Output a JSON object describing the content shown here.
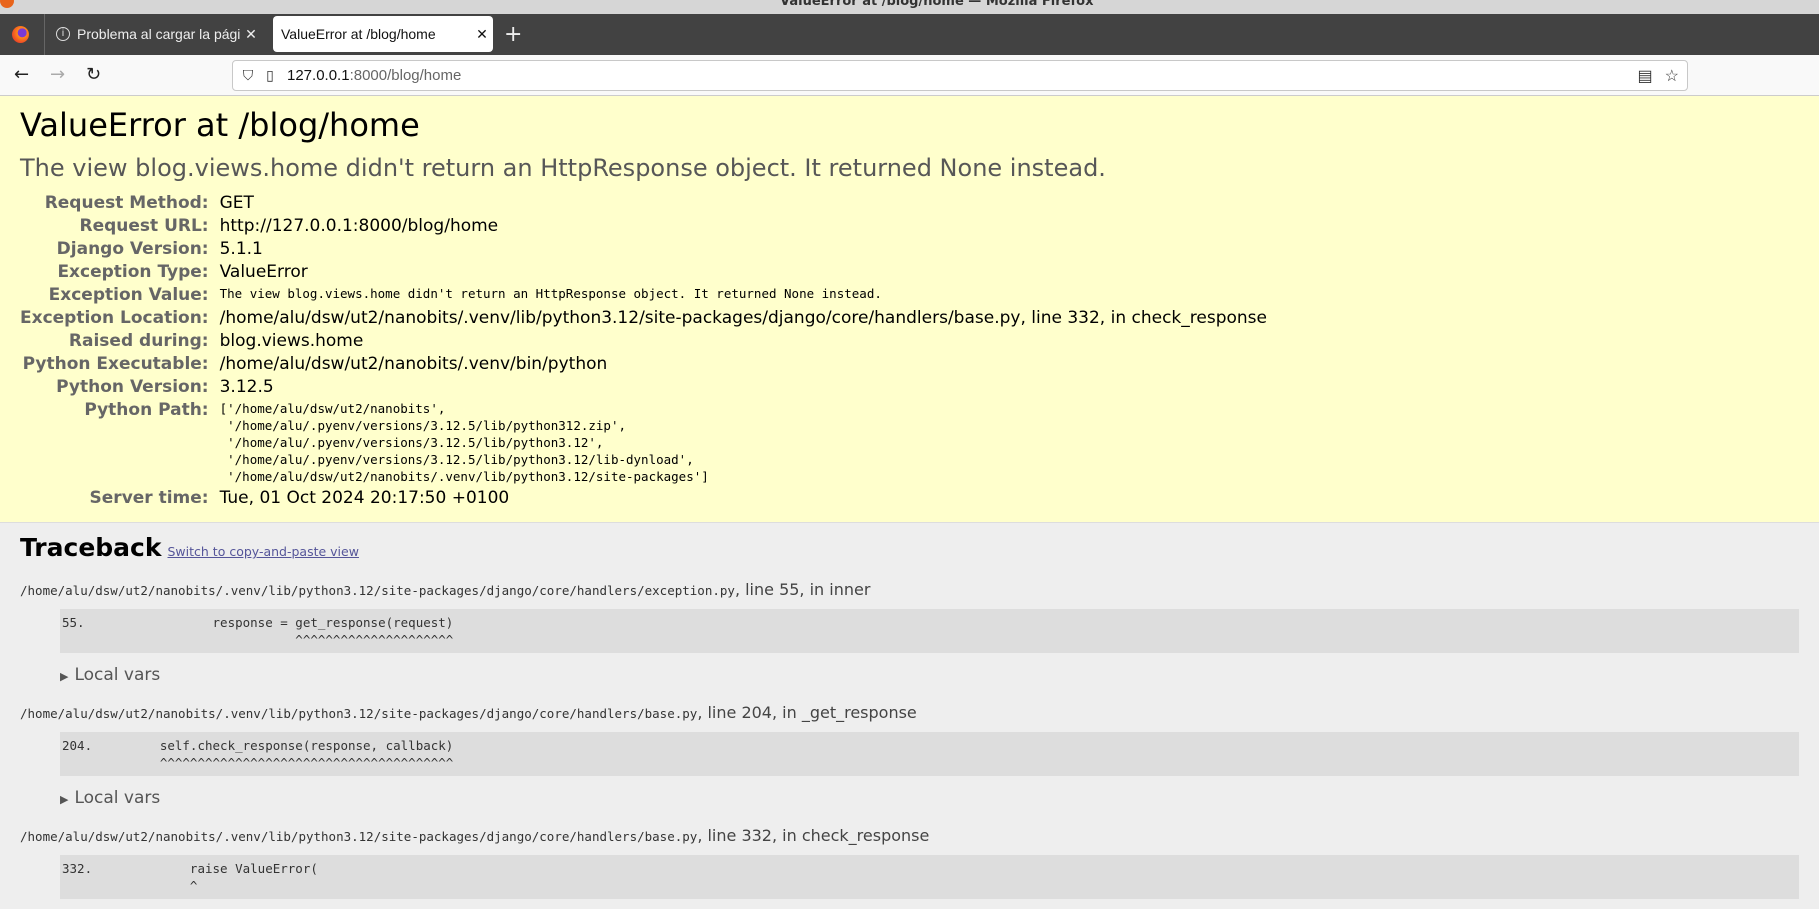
{
  "window": {
    "title": "ValueError at /blog/home — Mozilla Firefox"
  },
  "tabs": [
    {
      "label": "Problema al cargar la página",
      "active": false
    },
    {
      "label": "ValueError at /blog/home",
      "active": true
    }
  ],
  "nav": {
    "url_host": "127.0.0.1",
    "url_rest": ":8000/blog/home"
  },
  "summary": {
    "title": "ValueError at /blog/home",
    "subtitle": "The view blog.views.home didn't return an HttpResponse object. It returned None instead.",
    "rows": [
      {
        "label": "Request Method:",
        "value": "GET"
      },
      {
        "label": "Request URL:",
        "value": "http://127.0.0.1:8000/blog/home"
      },
      {
        "label": "Django Version:",
        "value": "5.1.1"
      },
      {
        "label": "Exception Type:",
        "value": "ValueError"
      },
      {
        "label": "Exception Value:",
        "value": "The view blog.views.home didn't return an HttpResponse object. It returned None instead."
      },
      {
        "label": "Exception Location:",
        "value": "/home/alu/dsw/ut2/nanobits/.venv/lib/python3.12/site-packages/django/core/handlers/base.py, line 332, in check_response"
      },
      {
        "label": "Raised during:",
        "value": "blog.views.home"
      },
      {
        "label": "Python Executable:",
        "value": "/home/alu/dsw/ut2/nanobits/.venv/bin/python"
      },
      {
        "label": "Python Version:",
        "value": "3.12.5"
      },
      {
        "label": "Python Path:",
        "value": "['/home/alu/dsw/ut2/nanobits',\n '/home/alu/.pyenv/versions/3.12.5/lib/python312.zip',\n '/home/alu/.pyenv/versions/3.12.5/lib/python3.12',\n '/home/alu/.pyenv/versions/3.12.5/lib/python3.12/lib-dynload',\n '/home/alu/dsw/ut2/nanobits/.venv/lib/python3.12/site-packages']"
      },
      {
        "label": "Server time:",
        "value": "Tue, 01 Oct 2024 20:17:50 +0100"
      }
    ]
  },
  "traceback": {
    "title": "Traceback",
    "switch_link": "Switch to copy-and-paste view",
    "local_vars_label": "Local vars",
    "frames": [
      {
        "file": "/home/alu/dsw/ut2/nanobits/.venv/lib/python3.12/site-packages/django/core/handlers/exception.py",
        "loc": ", line 55, in inner",
        "code": "55.                 response = get_response(request)\n                               ^^^^^^^^^^^^^^^^^^^^^"
      },
      {
        "file": "/home/alu/dsw/ut2/nanobits/.venv/lib/python3.12/site-packages/django/core/handlers/base.py",
        "loc": ", line 204, in _get_response",
        "code": "204.         self.check_response(response, callback)\n             ^^^^^^^^^^^^^^^^^^^^^^^^^^^^^^^^^^^^^^^"
      },
      {
        "file": "/home/alu/dsw/ut2/nanobits/.venv/lib/python3.12/site-packages/django/core/handlers/base.py",
        "loc": ", line 332, in check_response",
        "code": "332.             raise ValueError(\n                 ^"
      }
    ]
  }
}
